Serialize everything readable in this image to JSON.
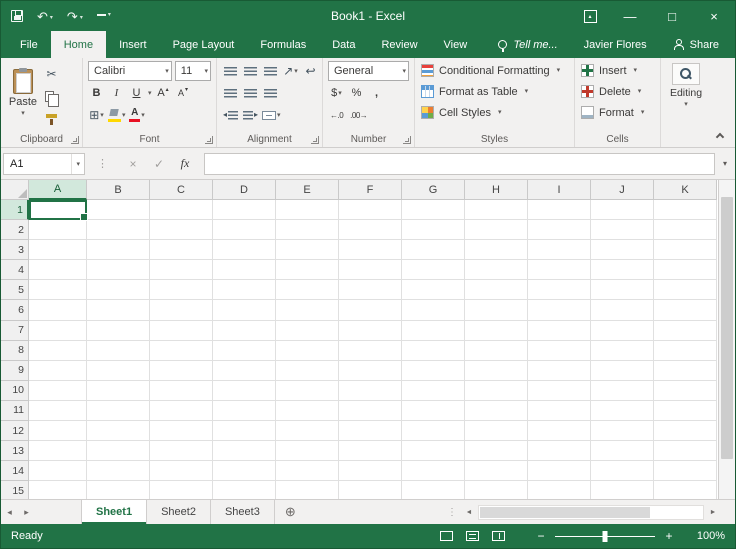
{
  "colors": {
    "excel_green": "#217346",
    "ribbon_bg": "#f2f1f0",
    "header_highlight": "#d2e8dc",
    "selection_border": "#217346"
  },
  "title_bar": {
    "title": "Book1 - Excel"
  },
  "icons": {
    "dropdown": "▾",
    "undo": "↶",
    "redo": "↷",
    "scissors": "✂",
    "borders": "⊞",
    "bold": "B",
    "italic": "I",
    "underline": "U",
    "letter_a": "A",
    "grow_arrow": "▴",
    "shrink_arrow": "▾",
    "orientation": "↗",
    "wrap_text": "↩",
    "indent_left": "◂",
    "indent_right": "▸",
    "dollar": "$",
    "percent": "%",
    "comma": ",",
    "increase_decimal": "←.0",
    "decrease_decimal": ".00→",
    "cancel": "×",
    "enter": "✓",
    "fx": "fx",
    "dots": "⋮",
    "tab_left": "◂",
    "tab_right": "▸",
    "scroll_left": "◄",
    "scroll_right": "►",
    "scroll_up": "▲",
    "scroll_down": "▼",
    "add_sheet": "⊕",
    "minus": "−",
    "plus": "+",
    "minimize": "—",
    "maximize": "□",
    "close": "×"
  },
  "ribbon_tabs": {
    "items": [
      "File",
      "Home",
      "Insert",
      "Page Layout",
      "Formulas",
      "Data",
      "Review",
      "View"
    ],
    "active": "Home",
    "tell_me": "Tell me...",
    "user_name": "Javier Flores",
    "share": "Share"
  },
  "ribbon": {
    "clipboard": {
      "label": "Clipboard",
      "paste": "Paste"
    },
    "font": {
      "label": "Font",
      "family": "Calibri",
      "size": "11"
    },
    "alignment": {
      "label": "Alignment"
    },
    "number": {
      "label": "Number",
      "format": "General"
    },
    "styles": {
      "label": "Styles",
      "conditional_formatting": "Conditional Formatting",
      "format_as_table": "Format as Table",
      "cell_styles": "Cell Styles"
    },
    "cells": {
      "label": "Cells",
      "insert": "Insert",
      "delete": "Delete",
      "format": "Format"
    },
    "editing": {
      "label": "Editing"
    }
  },
  "formula_bar": {
    "name_box": "A1",
    "formula": ""
  },
  "grid": {
    "columns": [
      "A",
      "B",
      "C",
      "D",
      "E",
      "F",
      "G",
      "H",
      "I",
      "J",
      "K"
    ],
    "rows": [
      "1",
      "2",
      "3",
      "4",
      "5",
      "6",
      "7",
      "8",
      "9",
      "10",
      "11",
      "12",
      "13",
      "14",
      "15"
    ],
    "selected_cell": "A1"
  },
  "sheet_bar": {
    "tabs": [
      "Sheet1",
      "Sheet2",
      "Sheet3"
    ],
    "active": "Sheet1"
  },
  "status_bar": {
    "status": "Ready",
    "zoom": "100%"
  }
}
